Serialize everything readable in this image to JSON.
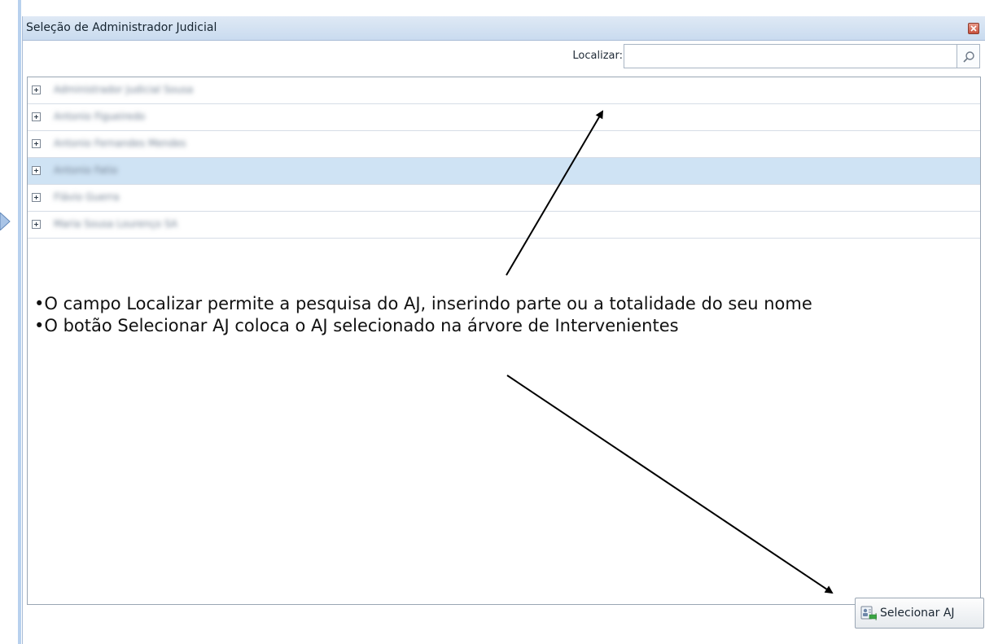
{
  "dialog": {
    "title": "Seleção de Administrador Judicial",
    "close_icon": "close-icon"
  },
  "search": {
    "label": "Localizar:",
    "value": "",
    "placeholder": "",
    "icon": "search-icon"
  },
  "tree": {
    "rows": [
      {
        "name": "Administrador Judicial Sousa",
        "selected": false
      },
      {
        "name": "Antonio Figueiredo",
        "selected": false
      },
      {
        "name": "Antonio Fernandes Mendes",
        "selected": false
      },
      {
        "name": "Antonio Fatio",
        "selected": false
      },
      {
        "name": "Flávio Guerra",
        "selected": false
      },
      {
        "name": "Maria Sousa Lourenço SA",
        "selected": false
      }
    ],
    "selected_row": 3,
    "expand_icon": "plus-square-icon"
  },
  "annotation": {
    "line1": "•O campo Localizar permite a pesquisa do AJ, inserindo parte ou a totalidade do seu nome",
    "line2": "•O botão Selecionar AJ coloca o AJ selecionado na árvore de Intervenientes"
  },
  "footer": {
    "select_button_label": "Selecionar AJ",
    "select_button_icon": "select-person-icon"
  },
  "colors": {
    "titlebar": "#c9dbef",
    "selected_row": "#cfe3f4",
    "border": "#9aa6b4"
  }
}
